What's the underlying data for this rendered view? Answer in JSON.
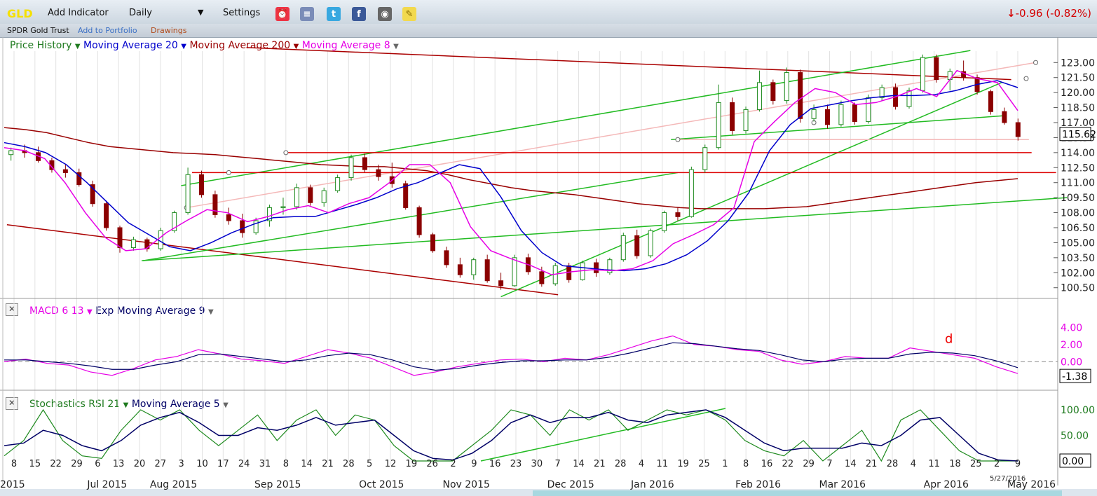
{
  "toolbar": {
    "ticker": "GLD",
    "add_indicator": "Add Indicator",
    "period": "Daily",
    "settings": "Settings",
    "change": "-0.96 (-0.82%)",
    "icons": [
      "alarm-clock-icon",
      "database-icon",
      "twitter-icon",
      "facebook-icon",
      "camera-icon",
      "sticky-note-icon"
    ]
  },
  "subbar": {
    "name": "SPDR Gold Trust",
    "add_portfolio": "Add to Portfolio",
    "drawings": "Drawings"
  },
  "colors": {
    "price_up": "#1e8a1e",
    "price_down": "#8b0000",
    "ma20": "#0000cc",
    "ma200": "#990000",
    "ma8": "#e600e6",
    "trend_green": "#22bb22",
    "trend_red": "#cc0000",
    "macd": "#e600e6",
    "signal": "#000066",
    "stoch": "#1e8a1e",
    "stoch_ma": "#000066"
  },
  "legends": {
    "price": [
      "Price History",
      "Moving Average 20",
      "Moving Average 200",
      "Moving Average 8"
    ],
    "macd": [
      "MACD 6 13",
      "Exp Moving Average 9"
    ],
    "stoch": [
      "Stochastics RSI 21",
      "Moving Average 5"
    ]
  },
  "chart_data": [
    {
      "type": "candlestick",
      "title": "GLD",
      "ylim": [
        99.5,
        124.0
      ],
      "yticks": [
        "123.00",
        "121.50",
        "120.00",
        "118.50",
        "117.00",
        "115.50",
        "114.00",
        "112.50",
        "111.00",
        "109.50",
        "108.00",
        "106.50",
        "105.00",
        "103.50",
        "102.00",
        "100.50"
      ],
      "last_value": "115.62",
      "ma20": [
        115.0,
        114.6,
        114.0,
        112.8,
        111.0,
        109.0,
        107.0,
        105.8,
        104.6,
        104.2,
        105.0,
        106.0,
        106.8,
        107.5,
        107.6,
        107.6,
        108.2,
        108.8,
        109.5,
        110.4,
        111.0,
        111.9,
        112.8,
        112.4,
        109.6,
        106.2,
        104.0,
        102.7,
        102.5,
        102.3,
        102.2,
        102.4,
        102.9,
        103.8,
        105.2,
        107.2,
        110.0,
        114.2,
        116.8,
        118.4,
        118.8,
        119.2,
        119.5,
        119.7,
        119.7,
        119.8,
        120.2,
        120.8,
        121.2,
        120.5
      ],
      "ma200": [
        116.5,
        116.3,
        116.0,
        115.5,
        115.0,
        114.6,
        114.4,
        114.2,
        114.0,
        113.9,
        113.8,
        113.6,
        113.4,
        113.2,
        113.0,
        112.8,
        112.7,
        112.6,
        112.6,
        112.4,
        112.2,
        111.8,
        111.3,
        110.9,
        110.5,
        110.2,
        110.0,
        109.8,
        109.5,
        109.2,
        108.9,
        108.7,
        108.5,
        108.4,
        108.4,
        108.4,
        108.4,
        108.5,
        108.6,
        108.9,
        109.2,
        109.5,
        109.8,
        110.1,
        110.4,
        110.7,
        111.0,
        111.2,
        111.4
      ],
      "ma8": [
        114.5,
        114.2,
        113.4,
        111.0,
        108.0,
        105.5,
        104.2,
        104.4,
        106.0,
        107.2,
        108.3,
        108.0,
        107.1,
        107.6,
        108.3,
        108.7,
        108.0,
        108.9,
        109.5,
        111.0,
        112.8,
        112.8,
        111.0,
        106.6,
        104.2,
        103.4,
        102.7,
        101.8,
        102.1,
        102.3,
        102.2,
        102.4,
        103.2,
        104.9,
        105.8,
        106.8,
        108.5,
        115.1,
        117.1,
        119.0,
        120.4,
        120.0,
        118.8,
        119.0,
        119.6,
        120.4,
        119.6,
        122.2,
        121.4,
        121.0,
        118.2
      ],
      "ohlc": [
        [
          113.8,
          114.5,
          113.2,
          114.2
        ],
        [
          114.2,
          114.8,
          113.5,
          114.0
        ],
        [
          114.0,
          114.6,
          113.0,
          113.2
        ],
        [
          113.2,
          113.5,
          112.0,
          112.3
        ],
        [
          112.3,
          112.8,
          111.5,
          112.0
        ],
        [
          112.0,
          112.4,
          110.6,
          110.8
        ],
        [
          110.8,
          111.2,
          108.6,
          108.9
        ],
        [
          108.9,
          109.2,
          106.2,
          106.5
        ],
        [
          106.5,
          106.7,
          104.0,
          104.5
        ],
        [
          104.5,
          105.6,
          104.2,
          105.3
        ],
        [
          105.3,
          105.5,
          104.1,
          104.4
        ],
        [
          104.4,
          106.5,
          104.2,
          106.2
        ],
        [
          106.2,
          108.2,
          106.0,
          108.0
        ],
        [
          108.0,
          112.5,
          107.8,
          111.8
        ],
        [
          111.8,
          112.2,
          109.5,
          109.8
        ],
        [
          109.8,
          110.2,
          107.5,
          107.8
        ],
        [
          107.8,
          108.5,
          106.8,
          107.2
        ],
        [
          107.2,
          107.9,
          105.5,
          106.0
        ],
        [
          106.0,
          107.5,
          105.8,
          107.2
        ],
        [
          107.2,
          108.8,
          106.6,
          108.5
        ],
        [
          108.5,
          109.5,
          107.8,
          108.6
        ],
        [
          108.6,
          110.9,
          108.3,
          110.5
        ],
        [
          110.5,
          110.8,
          108.7,
          109.0
        ],
        [
          109.0,
          110.5,
          108.6,
          110.2
        ],
        [
          110.2,
          111.8,
          110.0,
          111.5
        ],
        [
          111.5,
          113.8,
          111.2,
          113.5
        ],
        [
          113.5,
          113.9,
          112.0,
          112.3
        ],
        [
          112.3,
          112.8,
          111.2,
          111.6
        ],
        [
          111.6,
          113.0,
          110.5,
          110.9
        ],
        [
          110.9,
          111.2,
          108.3,
          108.5
        ],
        [
          108.5,
          108.7,
          105.5,
          105.8
        ],
        [
          105.8,
          106.0,
          104.0,
          104.2
        ],
        [
          104.2,
          104.6,
          102.5,
          102.8
        ],
        [
          102.8,
          103.5,
          101.5,
          101.8
        ],
        [
          101.8,
          103.5,
          101.3,
          103.3
        ],
        [
          103.3,
          103.8,
          101.0,
          101.2
        ],
        [
          101.2,
          102.0,
          100.3,
          100.7
        ],
        [
          100.7,
          103.8,
          100.6,
          103.5
        ],
        [
          103.5,
          103.9,
          101.8,
          102.1
        ],
        [
          102.1,
          102.6,
          100.6,
          100.9
        ],
        [
          100.9,
          103.0,
          100.7,
          102.7
        ],
        [
          102.7,
          103.0,
          101.0,
          101.3
        ],
        [
          101.3,
          103.2,
          101.2,
          103.0
        ],
        [
          103.0,
          103.4,
          101.6,
          102.0
        ],
        [
          102.0,
          103.5,
          101.8,
          103.3
        ],
        [
          103.3,
          106.0,
          103.1,
          105.7
        ],
        [
          105.7,
          106.3,
          103.4,
          103.7
        ],
        [
          103.7,
          106.4,
          103.5,
          106.2
        ],
        [
          106.2,
          108.2,
          106.0,
          108.0
        ],
        [
          108.0,
          108.5,
          107.2,
          107.6
        ],
        [
          107.6,
          112.6,
          107.5,
          112.3
        ],
        [
          112.3,
          114.8,
          112.0,
          114.5
        ],
        [
          114.5,
          120.8,
          114.3,
          119.0
        ],
        [
          119.0,
          119.5,
          115.8,
          116.2
        ],
        [
          116.2,
          118.6,
          115.9,
          118.3
        ],
        [
          118.3,
          122.2,
          118.1,
          121.0
        ],
        [
          121.0,
          121.3,
          118.8,
          119.2
        ],
        [
          119.2,
          122.5,
          118.9,
          122.0
        ],
        [
          122.0,
          122.3,
          117.0,
          117.4
        ],
        [
          117.4,
          118.8,
          117.1,
          118.3
        ],
        [
          118.3,
          118.8,
          116.4,
          116.8
        ],
        [
          116.8,
          119.2,
          116.6,
          118.8
        ],
        [
          118.8,
          119.0,
          116.8,
          117.1
        ],
        [
          117.1,
          119.8,
          116.9,
          119.5
        ],
        [
          119.5,
          120.8,
          119.2,
          120.5
        ],
        [
          120.5,
          120.9,
          118.3,
          118.6
        ],
        [
          118.6,
          120.5,
          118.4,
          120.2
        ],
        [
          120.2,
          123.8,
          120.0,
          123.5
        ],
        [
          123.5,
          123.8,
          121.0,
          121.3
        ],
        [
          121.3,
          122.4,
          120.2,
          122.1
        ],
        [
          122.1,
          123.2,
          121.2,
          121.5
        ],
        [
          121.5,
          121.8,
          119.8,
          120.1
        ],
        [
          120.1,
          120.3,
          117.8,
          118.1
        ],
        [
          118.1,
          118.5,
          116.8,
          117.0
        ],
        [
          117.0,
          117.4,
          115.2,
          115.6
        ]
      ]
    },
    {
      "type": "line",
      "title": "MACD 6 13",
      "ylim": [
        -3.0,
        5.0
      ],
      "yticks": [
        "4.00",
        "2.00",
        "0.00"
      ],
      "last_value": "-1.38",
      "annotation": "d",
      "series": [
        {
          "name": "MACD 6 13",
          "values": [
            0.0,
            0.3,
            -0.2,
            -0.4,
            -1.2,
            -1.6,
            -0.8,
            0.2,
            0.6,
            1.4,
            0.9,
            0.3,
            0.1,
            -0.2,
            0.6,
            1.4,
            1.0,
            0.4,
            -0.6,
            -1.6,
            -1.2,
            -0.6,
            -0.2,
            0.2,
            0.3,
            0.0,
            0.4,
            0.2,
            0.8,
            1.6,
            2.4,
            3.0,
            2.0,
            1.8,
            1.4,
            1.2,
            0.2,
            -0.3,
            0.0,
            0.6,
            0.4,
            0.4,
            1.6,
            1.2,
            0.8,
            0.4,
            -0.6,
            -1.38
          ]
        },
        {
          "name": "Exp Moving Average 9",
          "values": [
            0.2,
            0.2,
            0.0,
            -0.2,
            -0.5,
            -0.9,
            -0.9,
            -0.4,
            0.0,
            0.8,
            0.9,
            0.6,
            0.3,
            0.0,
            0.2,
            0.7,
            1.0,
            0.8,
            0.2,
            -0.6,
            -1.0,
            -0.8,
            -0.4,
            -0.1,
            0.1,
            0.1,
            0.2,
            0.2,
            0.5,
            1.0,
            1.6,
            2.2,
            2.1,
            1.8,
            1.5,
            1.3,
            0.8,
            0.2,
            0.0,
            0.3,
            0.4,
            0.4,
            0.9,
            1.1,
            1.0,
            0.7,
            0.1,
            -0.7
          ]
        }
      ]
    },
    {
      "type": "line",
      "title": "Stochastics RSI 21",
      "ylim": [
        0,
        100
      ],
      "yticks": [
        "100.00",
        "50.00",
        "0.00"
      ],
      "last_value": "0.00",
      "x_ticks": [
        "8",
        "15",
        "22",
        "29",
        "6",
        "13",
        "20",
        "27",
        "3",
        "10",
        "17",
        "24",
        "31",
        "8",
        "14",
        "21",
        "28",
        "5",
        "12",
        "19",
        "26",
        "2",
        "9",
        "16",
        "23",
        "30",
        "7",
        "14",
        "21",
        "28",
        "4",
        "11",
        "19",
        "25",
        "1",
        "8",
        "16",
        "22",
        "29",
        "7",
        "14",
        "21",
        "28",
        "4",
        "11",
        "18",
        "25",
        "2",
        "9"
      ],
      "x_months": [
        "2015",
        "Jul 2015",
        "Aug 2015",
        "Sep 2015",
        "Oct 2015",
        "Nov 2015",
        "Dec 2015",
        "Jan 2016",
        "Feb 2016",
        "Mar 2016",
        "Apr 2016",
        "May 2016"
      ],
      "last_date": "5/27/2016",
      "series": [
        {
          "name": "Stochastics RSI 21",
          "values": [
            10,
            40,
            100,
            40,
            10,
            5,
            60,
            100,
            80,
            100,
            60,
            30,
            60,
            90,
            40,
            80,
            100,
            50,
            90,
            80,
            30,
            0,
            0,
            0,
            30,
            60,
            100,
            90,
            50,
            100,
            80,
            100,
            60,
            80,
            100,
            90,
            100,
            80,
            40,
            20,
            10,
            40,
            0,
            30,
            60,
            0,
            80,
            100,
            60,
            20,
            0,
            0,
            0
          ]
        },
        {
          "name": "Moving Average 5",
          "values": [
            30,
            35,
            60,
            50,
            30,
            20,
            40,
            70,
            85,
            95,
            75,
            50,
            50,
            65,
            60,
            70,
            85,
            70,
            75,
            80,
            50,
            20,
            5,
            2,
            15,
            40,
            75,
            90,
            75,
            85,
            85,
            95,
            80,
            75,
            90,
            95,
            100,
            85,
            60,
            35,
            20,
            25,
            25,
            25,
            35,
            30,
            50,
            80,
            85,
            50,
            15,
            2,
            0
          ]
        }
      ]
    }
  ]
}
